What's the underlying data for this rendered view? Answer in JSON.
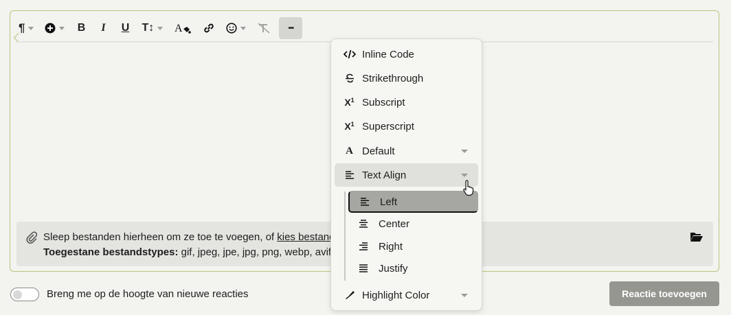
{
  "toolbar": {
    "buttons": [
      {
        "name": "paragraph-format",
        "icon": "pilcrow-icon"
      },
      {
        "name": "insert",
        "icon": "plus-circle-icon"
      },
      {
        "name": "bold",
        "glyph": "B"
      },
      {
        "name": "italic",
        "glyph": "I"
      },
      {
        "name": "underline",
        "glyph": "U"
      },
      {
        "name": "font-size",
        "glyph": "T↕"
      },
      {
        "name": "text-color",
        "icon": "font-color-icon"
      },
      {
        "name": "link",
        "icon": "link-icon"
      },
      {
        "name": "emoji",
        "icon": "smiley-icon"
      },
      {
        "name": "clear-format",
        "icon": "clear-format-icon"
      },
      {
        "name": "more",
        "glyph": "•••"
      }
    ]
  },
  "attachment": {
    "text_before": "Sleep bestanden hierheen om ze toe te voegen, of ",
    "link_text": "kies bestand",
    "types_label": "Toegestane bestandstypes:",
    "types_value": " gif, jpeg, jpe, jpg, png, webp, avif"
  },
  "footer": {
    "toggle_label": "Breng me op de hoogte van nieuwe reacties",
    "toggle_on": false,
    "submit_label": "Reactie toevoegen"
  },
  "menu": {
    "items": [
      {
        "label": "Inline Code",
        "icon": "code-icon"
      },
      {
        "label": "Strikethrough",
        "icon": "strikethrough-icon"
      },
      {
        "label": "Subscript",
        "icon": "subscript-icon"
      },
      {
        "label": "Superscript",
        "icon": "superscript-icon"
      },
      {
        "label": "Default",
        "icon": "font-icon",
        "has_dropdown": true
      },
      {
        "label": "Text Align",
        "icon": "align-left-icon",
        "has_dropdown": true,
        "expanded": true
      },
      {
        "label": "Highlight Color",
        "icon": "highlighter-icon",
        "has_dropdown": true
      }
    ],
    "text_align_options": [
      {
        "label": "Left",
        "icon": "align-left-icon",
        "selected": true
      },
      {
        "label": "Center",
        "icon": "align-center-icon"
      },
      {
        "label": "Right",
        "icon": "align-right-icon"
      },
      {
        "label": "Justify",
        "icon": "align-justify-icon"
      }
    ]
  },
  "colors": {
    "editor_border": "#b7c77a",
    "submit_bg": "#969691",
    "selected_bg": "#a6a6a2"
  }
}
